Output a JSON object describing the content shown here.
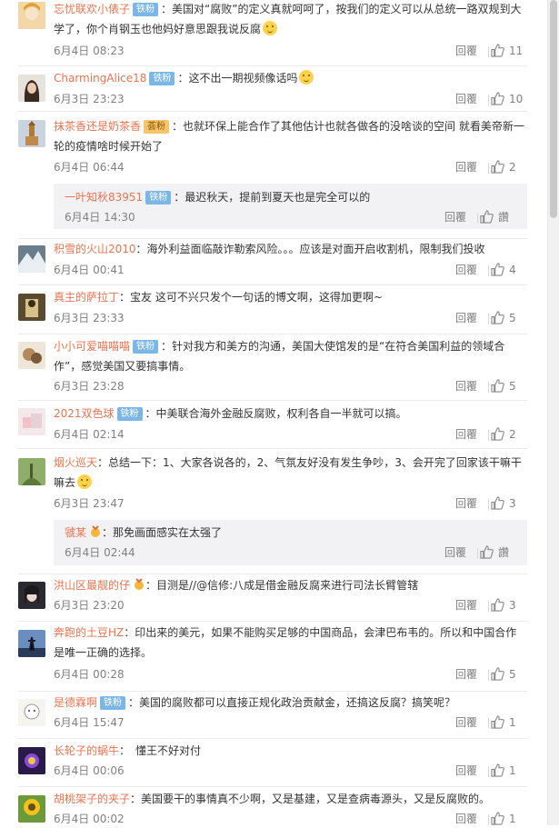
{
  "comments": [
    {
      "name": "忘忧联欢小俵子",
      "badge": "铁粉",
      "text": "：美国对“腐败”的定义真就呵呵了，按我们的定义可以从总统一路双规到大学了，你个肖钢玉也他妈好意思跟我说反腐",
      "emoji": true,
      "date": "6月4日 08:23",
      "reply": "回覆",
      "likes": "11"
    },
    {
      "name": "CharmingAlice18",
      "badge": "铁粉",
      "text": "：这不出一期视频像话吗",
      "emoji": true,
      "date": "6月3日 23:23",
      "reply": "回覆",
      "likes": "10"
    },
    {
      "name": "抹茶香还是奶茶香",
      "gold_badge": "荟粉",
      "text": "：也就环保上能合作了其他估计也就各做各的没啥谈的空间 就看美帝新一轮的疫情啥时候开始了",
      "date": "6月4日 06:44",
      "reply": "回覆",
      "likes": "2"
    },
    {
      "name": "积雪的火山2010",
      "text": "：海外利益面临敲诈勒索风险。。。应该是对面开启收割机，限制我们投收",
      "date": "6月4日 00:41",
      "reply": "回覆",
      "likes": "4"
    },
    {
      "name": "真主的萨拉丁",
      "text": "：宝友  这可不兴只发个一句话的博文啊，这得加更啊~",
      "date": "6月3日 23:33",
      "reply": "回覆",
      "likes": "5"
    },
    {
      "name": "小小可爱喵喵喵",
      "badge": "铁粉",
      "text": "：针对我方和美方的沟通，美国大使馆发的是“在符合美国利益的领域合作”，感觉美国又要搞事情。",
      "date": "6月3日 23:28",
      "reply": "回覆",
      "likes": "5"
    },
    {
      "name": "2021双色球",
      "badge": "铁粉",
      "text": "：中美联合海外金融反腐败，权利各自一半就可以搞。",
      "date": "6月4日 02:14",
      "reply": "回覆",
      "likes": "2"
    },
    {
      "name": "烟火巡天",
      "text": "：总结一下：1、大家各说各的，2、气氛友好没有发生争吵，3、会开完了回家该干嘛干嘛去",
      "emoji": true,
      "date": "6月3日 23:47",
      "reply": "回覆",
      "likes": "3"
    },
    {
      "name": "洪山区最靓的仔",
      "gold_icon": true,
      "text": "：目测是//@信修:八成是借金融反腐来进行司法长臂管辖",
      "date": "6月3日 23:20",
      "reply": "回覆",
      "likes": "3"
    },
    {
      "name": "奔跑的土豆HZ",
      "text": "：印出来的美元，如果不能购买足够的中国商品，会津巴布韦的。所以和中国合作是唯一正确的选择。",
      "date": "6月4日 00:28",
      "reply": "回覆",
      "likes": "5"
    },
    {
      "name": "是德霖啊",
      "badge": "铁粉",
      "text": "：美国的腐败都可以直接正规化政治贡献金，还搞这反腐？搞笑呢？",
      "date": "6月4日 15:47",
      "reply": "回覆",
      "likes": "1"
    },
    {
      "name": "长轮子的蜗牛",
      "text": "：　懂王不好对付",
      "date": "6月4日 00:06",
      "reply": "回覆",
      "likes": "1"
    },
    {
      "name": "胡桃架子的夹子",
      "text": "：美国要干的事情真不少啊，又是基建，又是查病毒源头，又是反腐败的。",
      "date": "6月4日 00:02",
      "reply": "回覆",
      "likes": "1"
    }
  ],
  "replies": [
    {
      "name": "一叶知秋83951",
      "badge": "铁粉",
      "text": "：最迟秋天，提前到夏天也是完全可以的",
      "date": "6月4日 14:30",
      "reply": "回覆",
      "likes": "讚"
    },
    {
      "name": "虢某",
      "gold_icon": true,
      "text": "：那免画面感实在太强了",
      "date": "6月4日 02:44",
      "reply": "回覆",
      "likes": "讚"
    }
  ],
  "colors": {
    "name": "#eb7350",
    "badge": "#7ab6e6",
    "meta": "#808080",
    "subbox": "#f2f2f5"
  },
  "icons": {
    "like": "thumbs-up-icon",
    "emoji": "smile-emoji-icon",
    "gold": "gold-medal-icon"
  }
}
